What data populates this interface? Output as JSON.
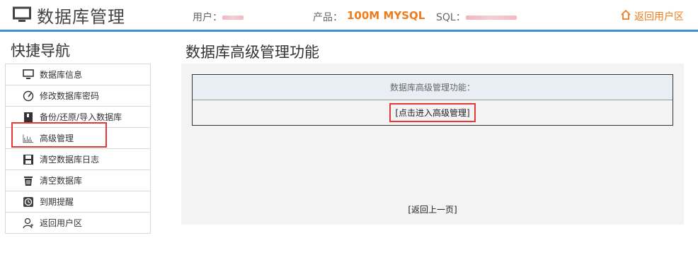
{
  "header": {
    "title": "数据库管理",
    "user_label": "用户：",
    "product_label": "产品：",
    "product_value": "100M MYSQL",
    "sql_label": "SQL：",
    "return_label": "返回用户区"
  },
  "nav": {
    "title": "快捷导航",
    "items": [
      {
        "label": "数据库信息",
        "icon": "monitor-icon"
      },
      {
        "label": "修改数据库密码",
        "icon": "gauge-icon"
      },
      {
        "label": "备份/还原/导入数据库",
        "icon": "archive-icon"
      },
      {
        "label": "高级管理",
        "icon": "chart-icon"
      },
      {
        "label": "清空数据库日志",
        "icon": "floppy-icon"
      },
      {
        "label": "清空数据库",
        "icon": "trash-icon"
      },
      {
        "label": "到期提醒",
        "icon": "clock-icon"
      },
      {
        "label": "返回用户区",
        "icon": "user-icon"
      }
    ]
  },
  "main": {
    "title": "数据库高级管理功能",
    "table_header": "数据库高级管理功能：",
    "enter_button": "[点击进入高级管理]",
    "back_link": "[返回上一页]"
  },
  "colors": {
    "accent": "#ef7b1a",
    "header_line": "#3d8fd6",
    "highlight": "#e53935"
  }
}
